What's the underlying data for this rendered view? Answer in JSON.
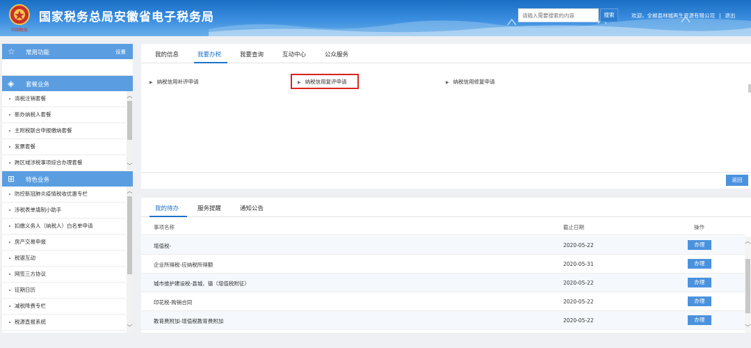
{
  "header": {
    "site_title": "国家税务总局安徽省电子税务局",
    "search_placeholder": "请输入需要搜索的内容",
    "search_button": "搜索",
    "welcome_text": "欢迎，全椒县林城再生资源有限公司",
    "logout": "退出"
  },
  "sidebar": {
    "favorites": {
      "label": "常用功能",
      "settings": "设置"
    },
    "package": {
      "label": "套餐业务",
      "items": [
        "清税注销套餐",
        "新办纳税人套餐",
        "主附税联合申报缴纳套餐",
        "发票套餐",
        "跨区域涉税事项综合办理套餐"
      ]
    },
    "featured": {
      "label": "特色业务",
      "items": [
        "防控新冠肺炎疫情税收优惠专栏",
        "涉税表单填制小助手",
        "扣缴义务人（纳税人）白名单申请",
        "房产交易申报",
        "税银互动",
        "网签三方协议",
        "征期日历",
        "减税降费专栏",
        "税源直报系统"
      ]
    }
  },
  "main_tabs": [
    "我的信息",
    "我要办税",
    "我要查询",
    "互动中心",
    "公众服务"
  ],
  "links": [
    "纳税信用补评申请",
    "纳税信用复评申请",
    "纳税信用修复申请"
  ],
  "back_button": "返回",
  "bottom_tabs": [
    "我的待办",
    "服务提醒",
    "通知公告"
  ],
  "table": {
    "headers": [
      "事项名称",
      "截止日期",
      "操作"
    ],
    "rows": [
      {
        "name": "增值税-",
        "date": "2020-05-22",
        "action": "办理"
      },
      {
        "name": "企业所得税-应纳税所得额",
        "date": "2020-05-31",
        "action": "办理"
      },
      {
        "name": "城市维护建设税-县城、镇（增值税附征）",
        "date": "2020-05-22",
        "action": "办理"
      },
      {
        "name": "印花税-购销合同",
        "date": "2020-05-22",
        "action": "办理"
      },
      {
        "name": "教育费附加-增值税教育费附加",
        "date": "2020-05-22",
        "action": "办理"
      }
    ]
  },
  "colors": {
    "header_blue": "#1a6fc4",
    "accent_blue": "#1a73c9",
    "button_blue": "#4a92de",
    "highlight_red": "#d9221e"
  }
}
